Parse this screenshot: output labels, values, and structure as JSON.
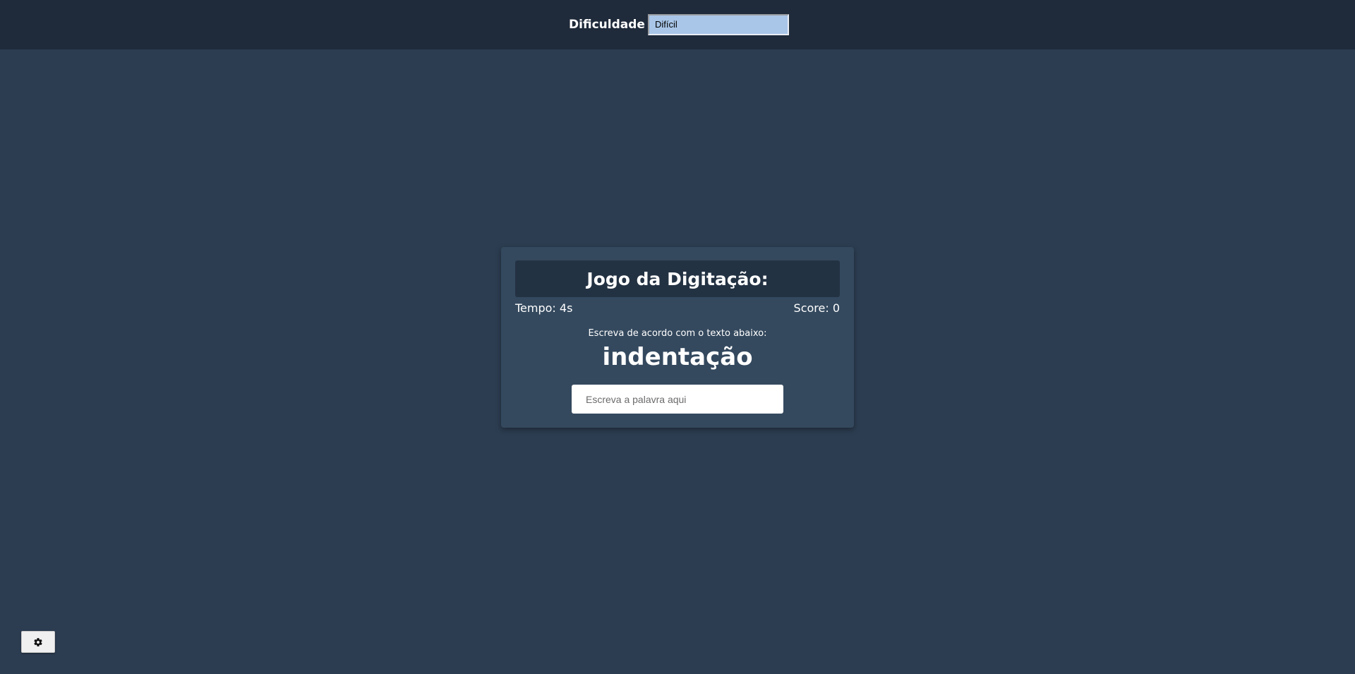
{
  "header": {
    "difficulty_label": "Dificuldade",
    "difficulty_selected": "Difícil"
  },
  "game": {
    "title": "Jogo da Digitação:",
    "time": "Tempo: 4s",
    "score": "Score: 0",
    "instruction": "Escreva de acordo com o texto abaixo:",
    "word": "indentação",
    "input_placeholder": "Escreva a palavra aqui",
    "input_value": ""
  },
  "footer": {
    "settings_icon": "gear-icon"
  },
  "colors": {
    "background": "#2c3d51",
    "topbar": "#1f2a3a",
    "card": "#34495e",
    "card_header": "#233243",
    "select_bg": "#a9c6e8"
  }
}
